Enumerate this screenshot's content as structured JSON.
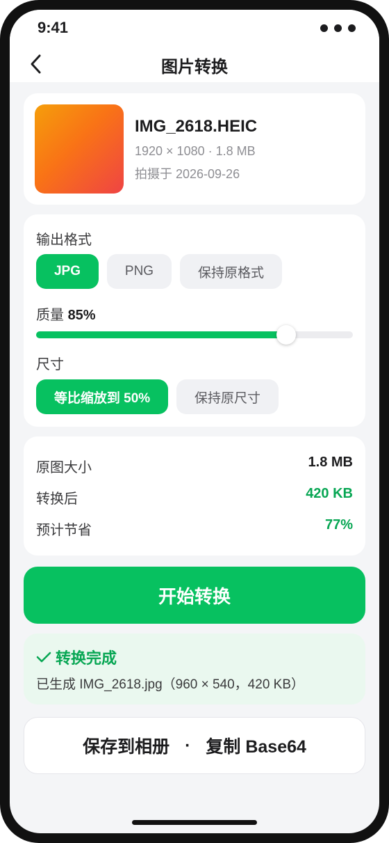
{
  "status_bar": {
    "time": "9:41"
  },
  "nav": {
    "title": "图片转换"
  },
  "file": {
    "name": "IMG_2618.HEIC",
    "meta": "1920 × 1080 · 1.8 MB",
    "date": "拍摄于 2026-09-26"
  },
  "format": {
    "label": "输出格式",
    "options": [
      "JPG",
      "PNG",
      "保持原格式"
    ],
    "selected": "JPG"
  },
  "quality": {
    "label": "质量",
    "value_text": "85%",
    "value": 85
  },
  "size": {
    "label": "尺寸",
    "options": [
      "等比缩放到 50%",
      "保持原尺寸"
    ],
    "selected": "等比缩放到 50%"
  },
  "stats": [
    {
      "label": "原图大小",
      "value": "1.8 MB"
    },
    {
      "label": "转换后",
      "value": "420 KB"
    },
    {
      "label": "预计节省",
      "value": "77%"
    }
  ],
  "start_button": "开始转换",
  "result": {
    "title": "转换完成",
    "description": "已生成 IMG_2618.jpg（960 × 540，420 KB）"
  },
  "actions": {
    "save": "保存到相册",
    "separator": "·",
    "copy": "复制 Base64"
  },
  "colors": {
    "accent": "#07c160",
    "accent_text": "#07a653",
    "result_bg": "#eaf8ef"
  }
}
